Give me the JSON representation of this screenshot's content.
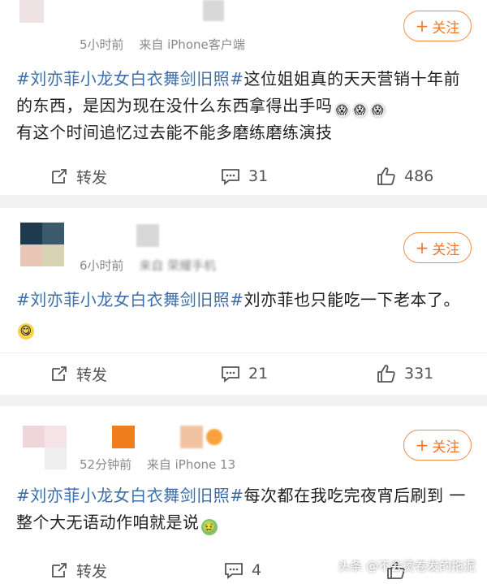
{
  "colors": {
    "accent": "#f0762a",
    "hashtag": "#3b6ea8",
    "meta": "#8a8a8a"
  },
  "posts": [
    {
      "time": "5小时前",
      "source": "来自 iPhone客户端",
      "follow_label": "关注",
      "hashtag": "#刘亦菲小龙女白衣舞剑旧照#",
      "text": "这位姐姐真的天天营销十年前的东西，是因为现在没什么东西拿得出手吗",
      "text2": "有这个时间追忆过去能不能多磨练磨练演技",
      "emoji": [
        "crying-face-emoji",
        "crying-face-emoji",
        "crying-face-emoji"
      ],
      "repost_label": "转发",
      "comments": "31",
      "likes": "486"
    },
    {
      "time": "6小时前",
      "source": "来自 荣耀手机",
      "follow_label": "关注",
      "hashtag": "#刘亦菲小龙女白衣舞剑旧照#",
      "text": "刘亦菲也只能吃一下老本了。",
      "emoji": [
        "yummy-face-emoji"
      ],
      "repost_label": "转发",
      "comments": "21",
      "likes": "331"
    },
    {
      "time": "52分钟前",
      "source": "来自 iPhone 13",
      "follow_label": "关注",
      "hashtag": "#刘亦菲小龙女白衣舞剑旧照#",
      "text": "每次都在我吃完夜宵后刷到 一整个大无语动作咱就是说",
      "emoji": [
        "nauseated-face-emoji"
      ],
      "repost_label": "转发",
      "comments": "4",
      "likes": ""
    }
  ],
  "watermark": "头条 @不会烫卷发的拖泥"
}
